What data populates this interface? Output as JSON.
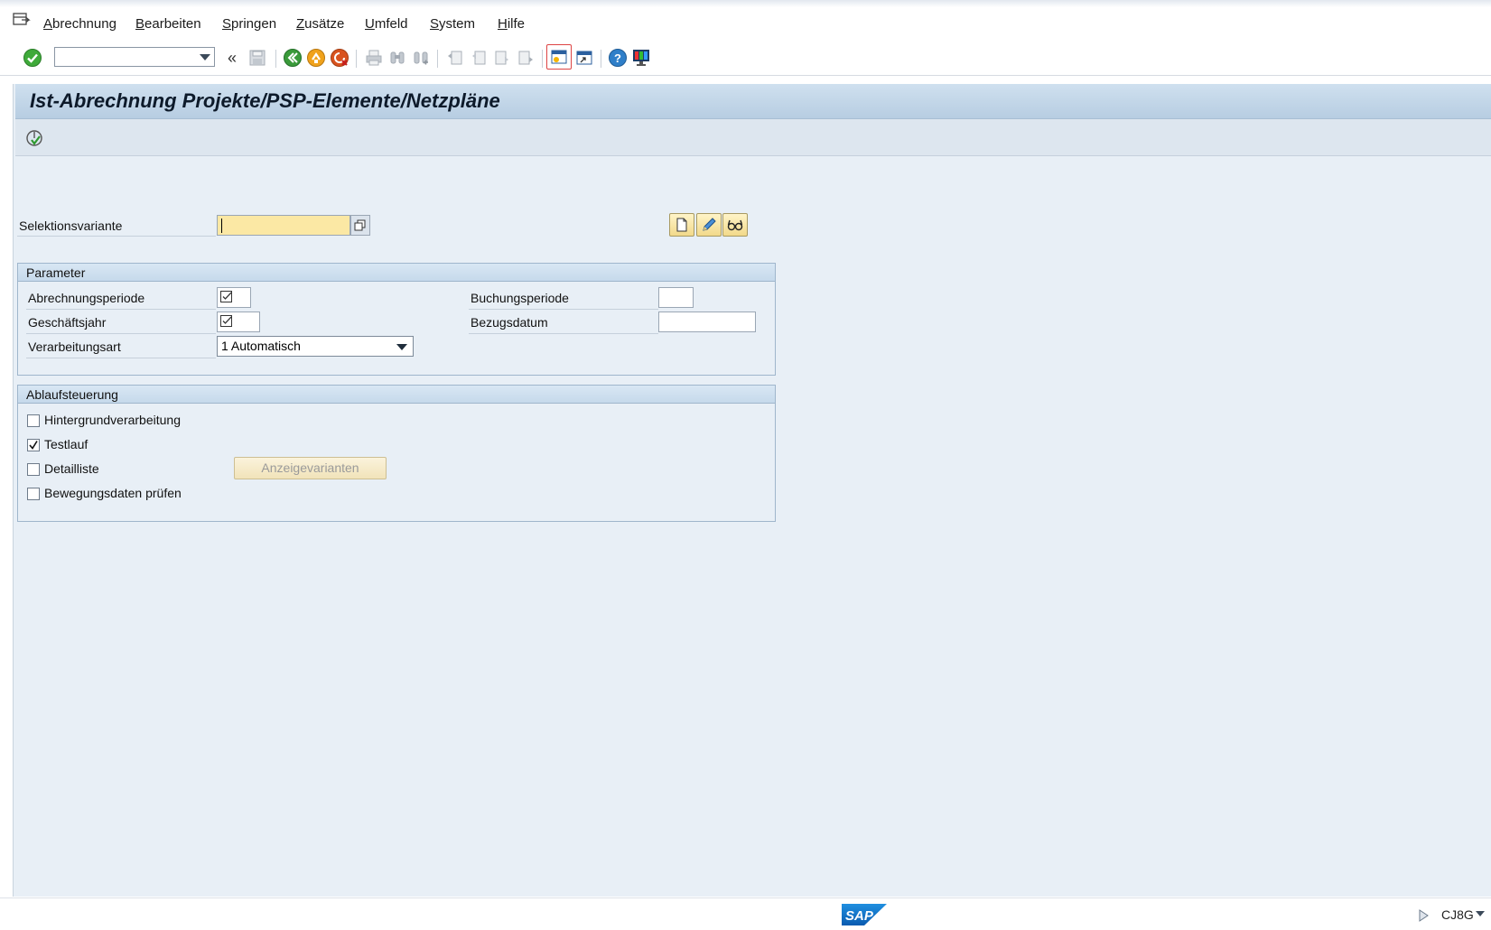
{
  "menu": {
    "items": [
      {
        "mnemonic": "A",
        "rest": "brechnung"
      },
      {
        "mnemonic": "B",
        "rest": "earbeiten"
      },
      {
        "mnemonic": "S",
        "rest": "pringen"
      },
      {
        "mnemonic": "Z",
        "rest": "usätze"
      },
      {
        "mnemonic": "U",
        "rest": "mfeld"
      },
      {
        "mnemonic": "S",
        "rest": "ystem"
      },
      {
        "mnemonic": "H",
        "rest": "ilfe"
      }
    ]
  },
  "toolbar": {
    "command_value": "",
    "icons": [
      "enter-icon",
      "back-icon",
      "exit-icon",
      "cancel-icon",
      "print-icon",
      "find-icon",
      "find-next-icon",
      "first-page-icon",
      "prev-page-icon",
      "next-page-icon",
      "last-page-icon",
      "new-session-icon",
      "shortcut-icon",
      "help-icon",
      "customize-layout-icon"
    ]
  },
  "title": "Ist-Abrechnung Projekte/PSP-Elemente/Netzpläne",
  "variant": {
    "label": "Selektionsvariante",
    "value": ""
  },
  "parameter": {
    "header": "Parameter",
    "abrechnungsperiode_label": "Abrechnungsperiode",
    "geschaeftsjahr_label": "Geschäftsjahr",
    "verarbeitungsart_label": "Verarbeitungsart",
    "verarbeitungsart_value": "1 Automatisch",
    "buchungsperiode_label": "Buchungsperiode",
    "bezugsdatum_label": "Bezugsdatum",
    "buchungsperiode_value": "",
    "bezugsdatum_value": ""
  },
  "ablauf": {
    "header": "Ablaufsteuerung",
    "hintergrund_label": "Hintergrundverarbeitung",
    "hintergrund_checked": false,
    "testlauf_label": "Testlauf",
    "testlauf_checked": true,
    "detailliste_label": "Detailliste",
    "detailliste_checked": false,
    "bewegung_label": "Bewegungsdaten prüfen",
    "bewegung_checked": false,
    "anzeige_button": "Anzeigevarianten"
  },
  "status": {
    "logo_text": "SAP",
    "system_id": "CJ8G"
  },
  "colors": {
    "title_bar": "#b7cde2",
    "main_bg": "#e8eff6",
    "required_field": "#fbe8a4"
  }
}
